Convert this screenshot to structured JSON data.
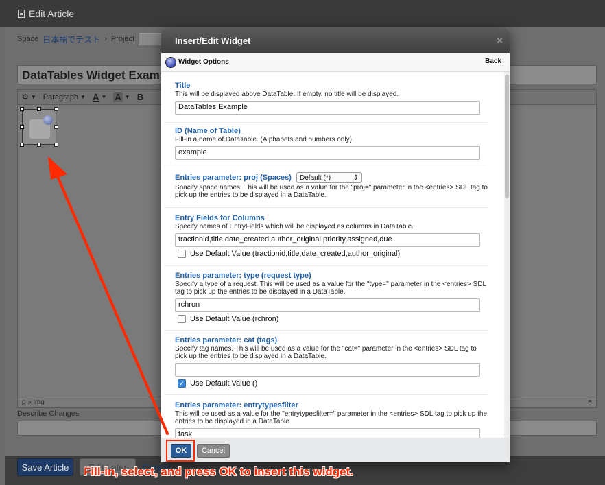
{
  "window": {
    "title": "Edit Article",
    "breadcrumb": {
      "space_label": "Space",
      "space_name": "日本語でテスト",
      "sep": "›",
      "project_label": "Project"
    },
    "article_title": "DataTables Widget Exampl",
    "toolbar": {
      "paragraph": "Paragraph",
      "font_color": "A",
      "highlight": "A",
      "bold": "B"
    },
    "status_path": "p » img",
    "describe_label": "Describe Changes",
    "save_button": "Save Article",
    "later_button": "Edit Later",
    "cancel_link": "Cancel"
  },
  "callout": "Fill-in, select, and press OK to insert this widget.",
  "modal": {
    "title": "Insert/Edit Widget",
    "close": "×",
    "options_label": "Widget Options",
    "back": "Back",
    "sections": {
      "title": {
        "label": "Title",
        "help": "This will be displayed above DataTable. If empty, no title will be displayed.",
        "value": "DataTables Example"
      },
      "id": {
        "label": "ID (Name of Table)",
        "help": "Fill-in a name of DataTable. (Alphabets and numbers only)",
        "value": "example"
      },
      "proj": {
        "label": "Entries parameter: proj (Spaces)",
        "select": "Default (*)",
        "help": "Spacify space names. This will be used as a value for the \"proj=\" parameter in the <entries> SDL tag to pick up the entries to be displayed in a DataTable."
      },
      "fields": {
        "label": "Entry Fields for Columns",
        "help": "Specify names of EntryFields which will be displayed as columns in DataTable.",
        "value": "tractionid,title,date_created,author_original,priority,assigned,due",
        "default_label": "Use Default Value (tractionid,title,date_created,author_original)",
        "default_checked": false
      },
      "type": {
        "label": "Entries parameter: type (request type)",
        "help": "Specify a type of a request. This will be used as a value for the \"type=\" parameter in the <entries> SDL tag to pick up the entries to be displayed in a DataTable.",
        "value": "rchron",
        "default_label": "Use Default Value (rchron)",
        "default_checked": false
      },
      "cat": {
        "label": "Entries parameter: cat (tags)",
        "help": "Specify tag names. This will be used as a value for the \"cat=\" parameter in the <entries> SDL tag to pick up the entries to be displayed in a DataTable.",
        "value": "",
        "default_label": "Use Default Value ()",
        "default_checked": true
      },
      "etf": {
        "label": "Entries parameter: entrytypesfilter",
        "help": "This will be used as a value for the \"entrytypesfilter=\" parameter in the <entries> SDL tag to pick up the entries to be displayed in a DataTable.",
        "value": "task"
      }
    },
    "ok": "OK",
    "cancel": "Cancel"
  },
  "colors": {
    "accent": "#1f5fa8",
    "annotation": "#ff2a00",
    "ok": "#2a5d96"
  }
}
